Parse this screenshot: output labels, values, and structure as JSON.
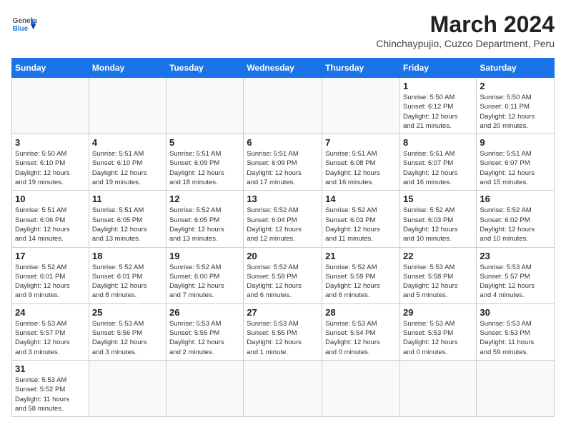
{
  "header": {
    "logo_general": "General",
    "logo_blue": "Blue",
    "month_title": "March 2024",
    "location": "Chinchaypujio, Cuzco Department, Peru"
  },
  "weekdays": [
    "Sunday",
    "Monday",
    "Tuesday",
    "Wednesday",
    "Thursday",
    "Friday",
    "Saturday"
  ],
  "weeks": [
    [
      {
        "day": "",
        "info": ""
      },
      {
        "day": "",
        "info": ""
      },
      {
        "day": "",
        "info": ""
      },
      {
        "day": "",
        "info": ""
      },
      {
        "day": "",
        "info": ""
      },
      {
        "day": "1",
        "info": "Sunrise: 5:50 AM\nSunset: 6:12 PM\nDaylight: 12 hours\nand 21 minutes."
      },
      {
        "day": "2",
        "info": "Sunrise: 5:50 AM\nSunset: 6:11 PM\nDaylight: 12 hours\nand 20 minutes."
      }
    ],
    [
      {
        "day": "3",
        "info": "Sunrise: 5:50 AM\nSunset: 6:10 PM\nDaylight: 12 hours\nand 19 minutes."
      },
      {
        "day": "4",
        "info": "Sunrise: 5:51 AM\nSunset: 6:10 PM\nDaylight: 12 hours\nand 19 minutes."
      },
      {
        "day": "5",
        "info": "Sunrise: 5:51 AM\nSunset: 6:09 PM\nDaylight: 12 hours\nand 18 minutes."
      },
      {
        "day": "6",
        "info": "Sunrise: 5:51 AM\nSunset: 6:09 PM\nDaylight: 12 hours\nand 17 minutes."
      },
      {
        "day": "7",
        "info": "Sunrise: 5:51 AM\nSunset: 6:08 PM\nDaylight: 12 hours\nand 16 minutes."
      },
      {
        "day": "8",
        "info": "Sunrise: 5:51 AM\nSunset: 6:07 PM\nDaylight: 12 hours\nand 16 minutes."
      },
      {
        "day": "9",
        "info": "Sunrise: 5:51 AM\nSunset: 6:07 PM\nDaylight: 12 hours\nand 15 minutes."
      }
    ],
    [
      {
        "day": "10",
        "info": "Sunrise: 5:51 AM\nSunset: 6:06 PM\nDaylight: 12 hours\nand 14 minutes."
      },
      {
        "day": "11",
        "info": "Sunrise: 5:51 AM\nSunset: 6:05 PM\nDaylight: 12 hours\nand 13 minutes."
      },
      {
        "day": "12",
        "info": "Sunrise: 5:52 AM\nSunset: 6:05 PM\nDaylight: 12 hours\nand 13 minutes."
      },
      {
        "day": "13",
        "info": "Sunrise: 5:52 AM\nSunset: 6:04 PM\nDaylight: 12 hours\nand 12 minutes."
      },
      {
        "day": "14",
        "info": "Sunrise: 5:52 AM\nSunset: 6:03 PM\nDaylight: 12 hours\nand 11 minutes."
      },
      {
        "day": "15",
        "info": "Sunrise: 5:52 AM\nSunset: 6:03 PM\nDaylight: 12 hours\nand 10 minutes."
      },
      {
        "day": "16",
        "info": "Sunrise: 5:52 AM\nSunset: 6:02 PM\nDaylight: 12 hours\nand 10 minutes."
      }
    ],
    [
      {
        "day": "17",
        "info": "Sunrise: 5:52 AM\nSunset: 6:01 PM\nDaylight: 12 hours\nand 9 minutes."
      },
      {
        "day": "18",
        "info": "Sunrise: 5:52 AM\nSunset: 6:01 PM\nDaylight: 12 hours\nand 8 minutes."
      },
      {
        "day": "19",
        "info": "Sunrise: 5:52 AM\nSunset: 6:00 PM\nDaylight: 12 hours\nand 7 minutes."
      },
      {
        "day": "20",
        "info": "Sunrise: 5:52 AM\nSunset: 5:59 PM\nDaylight: 12 hours\nand 6 minutes."
      },
      {
        "day": "21",
        "info": "Sunrise: 5:52 AM\nSunset: 5:59 PM\nDaylight: 12 hours\nand 6 minutes."
      },
      {
        "day": "22",
        "info": "Sunrise: 5:53 AM\nSunset: 5:58 PM\nDaylight: 12 hours\nand 5 minutes."
      },
      {
        "day": "23",
        "info": "Sunrise: 5:53 AM\nSunset: 5:57 PM\nDaylight: 12 hours\nand 4 minutes."
      }
    ],
    [
      {
        "day": "24",
        "info": "Sunrise: 5:53 AM\nSunset: 5:57 PM\nDaylight: 12 hours\nand 3 minutes."
      },
      {
        "day": "25",
        "info": "Sunrise: 5:53 AM\nSunset: 5:56 PM\nDaylight: 12 hours\nand 3 minutes."
      },
      {
        "day": "26",
        "info": "Sunrise: 5:53 AM\nSunset: 5:55 PM\nDaylight: 12 hours\nand 2 minutes."
      },
      {
        "day": "27",
        "info": "Sunrise: 5:53 AM\nSunset: 5:55 PM\nDaylight: 12 hours\nand 1 minute."
      },
      {
        "day": "28",
        "info": "Sunrise: 5:53 AM\nSunset: 5:54 PM\nDaylight: 12 hours\nand 0 minutes."
      },
      {
        "day": "29",
        "info": "Sunrise: 5:53 AM\nSunset: 5:53 PM\nDaylight: 12 hours\nand 0 minutes."
      },
      {
        "day": "30",
        "info": "Sunrise: 5:53 AM\nSunset: 5:53 PM\nDaylight: 11 hours\nand 59 minutes."
      }
    ],
    [
      {
        "day": "31",
        "info": "Sunrise: 5:53 AM\nSunset: 5:52 PM\nDaylight: 11 hours\nand 58 minutes."
      },
      {
        "day": "",
        "info": ""
      },
      {
        "day": "",
        "info": ""
      },
      {
        "day": "",
        "info": ""
      },
      {
        "day": "",
        "info": ""
      },
      {
        "day": "",
        "info": ""
      },
      {
        "day": "",
        "info": ""
      }
    ]
  ]
}
